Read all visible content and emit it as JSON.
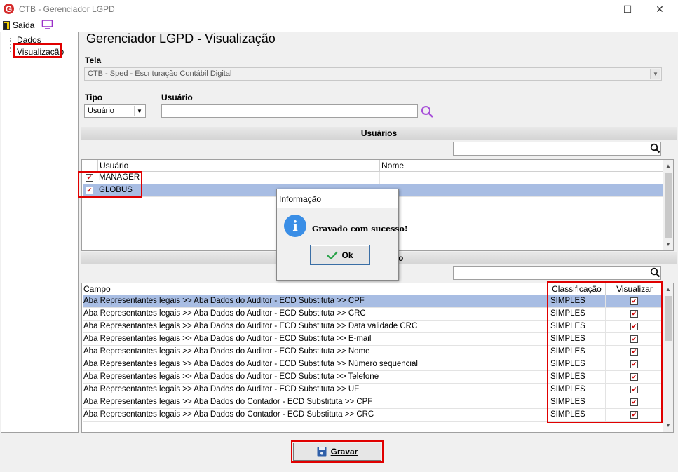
{
  "window": {
    "title": "CTB - Gerenciador LGPD",
    "minimize": "—",
    "maximize": "☐",
    "close": "✕"
  },
  "menu": {
    "saida_label": "Saída"
  },
  "tree": {
    "items": [
      {
        "label": "Dados"
      },
      {
        "label": "Visualização"
      }
    ]
  },
  "main": {
    "title": "Gerenciador LGPD - Visualização",
    "tela_label": "Tela",
    "tela_value": "CTB - Sped - Escrituração Contábil Digital",
    "tipo_label": "Tipo",
    "tipo_value": "Usuário",
    "usuario_label": "Usuário",
    "usuario_value": ""
  },
  "usuarios_section": {
    "header": "Usuários",
    "columns": [
      "Usuário",
      "Nome"
    ],
    "rows": [
      {
        "checked": true,
        "usuario": "MANAGER",
        "nome": ""
      },
      {
        "checked": true,
        "usuario": "GLOBUS",
        "nome": ""
      }
    ]
  },
  "campos_section": {
    "header_fragment": "o",
    "columns": [
      "Campo",
      "Classificação",
      "Visualizar"
    ],
    "rows": [
      {
        "campo": "Aba Representantes legais >> Aba Dados do Auditor - ECD Substituta >> CPF",
        "classificacao": "SIMPLES",
        "visualizar": true
      },
      {
        "campo": "Aba Representantes legais >> Aba Dados do Auditor - ECD Substituta >> CRC",
        "classificacao": "SIMPLES",
        "visualizar": true
      },
      {
        "campo": "Aba Representantes legais >> Aba Dados do Auditor - ECD Substituta >> Data validade CRC",
        "classificacao": "SIMPLES",
        "visualizar": true
      },
      {
        "campo": "Aba Representantes legais >> Aba Dados do Auditor - ECD Substituta >> E-mail",
        "classificacao": "SIMPLES",
        "visualizar": true
      },
      {
        "campo": "Aba Representantes legais >> Aba Dados do Auditor - ECD Substituta >> Nome",
        "classificacao": "SIMPLES",
        "visualizar": true
      },
      {
        "campo": "Aba Representantes legais >> Aba Dados do Auditor - ECD Substituta >> Número sequencial",
        "classificacao": "SIMPLES",
        "visualizar": true
      },
      {
        "campo": "Aba Representantes legais >> Aba Dados do Auditor - ECD Substituta >> Telefone",
        "classificacao": "SIMPLES",
        "visualizar": true
      },
      {
        "campo": "Aba Representantes legais >> Aba Dados do Auditor - ECD Substituta >> UF",
        "classificacao": "SIMPLES",
        "visualizar": true
      },
      {
        "campo": "Aba Representantes legais >> Aba Dados do Contador - ECD Substituta >> CPF",
        "classificacao": "SIMPLES",
        "visualizar": true
      },
      {
        "campo": "Aba Representantes legais >> Aba Dados do Contador - ECD Substituta >> CRC",
        "classificacao": "SIMPLES",
        "visualizar": true
      }
    ]
  },
  "dialog": {
    "title": "Informação",
    "message": "Gravado com sucesso!",
    "ok_label": "Ok"
  },
  "footer": {
    "gravar_label": "Gravar"
  },
  "colors": {
    "selection": "#a8bde3",
    "highlight_box": "#e00000",
    "info_blue": "#3a8ee6",
    "check_red": "#cc0000"
  }
}
